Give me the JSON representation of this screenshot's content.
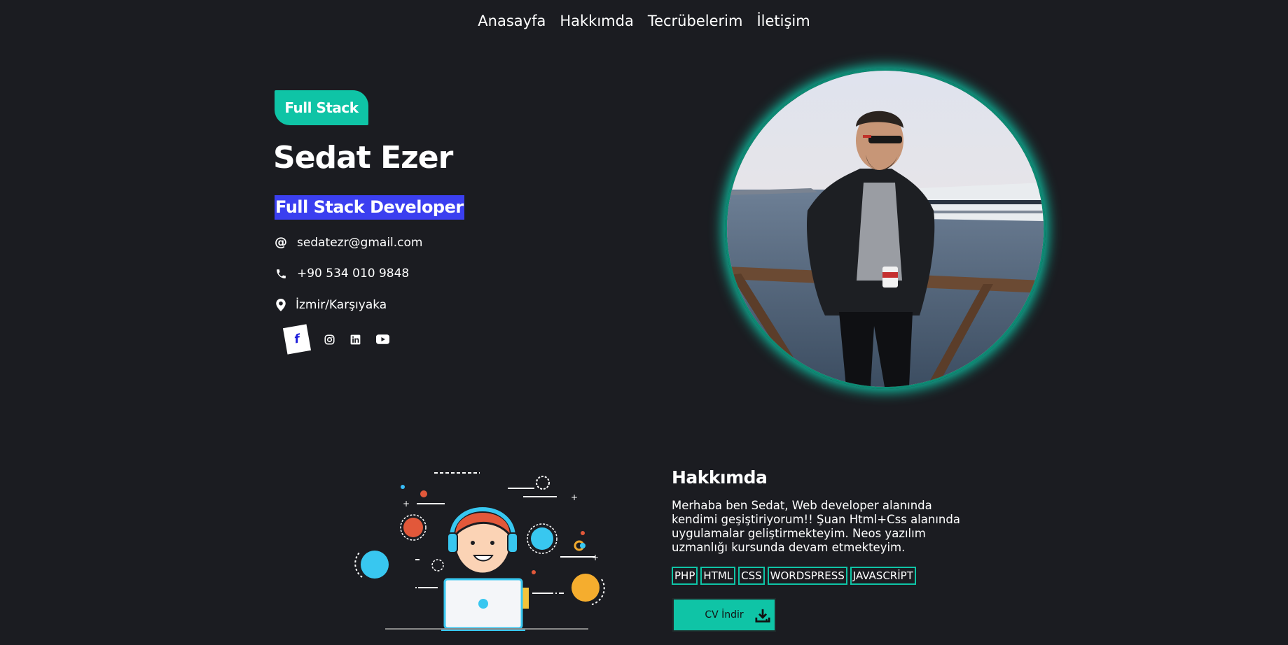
{
  "nav": {
    "items": [
      {
        "label": "Anasayfa"
      },
      {
        "label": "Hakkımda"
      },
      {
        "label": "Tecrübelerim"
      },
      {
        "label": "İletişim"
      }
    ]
  },
  "hero": {
    "badge": "Full Stack",
    "name": "Sedat Ezer",
    "role": "Full Stack Developer",
    "email": "sedatezr@gmail.com",
    "phone": "+90 534 010 9848",
    "location": "İzmir/Karşıyaka",
    "social": {
      "facebook": "f",
      "icons": [
        "facebook-icon",
        "instagram-icon",
        "linkedin-icon",
        "youtube-icon"
      ]
    }
  },
  "about": {
    "title": "Hakkımda",
    "text": "Merhaba ben Sedat, Web developer alanında kendimi geşiştiriyorum!! Şuan Html+Css alanında uygulamalar geliştirmekteyim. Neos yazılım uzmanlığı kursunda devam etmekteyim.",
    "skills": [
      "PHP",
      "HTML",
      "CSS",
      "WORDSPRESS",
      "JAVASCRİPT"
    ],
    "cv_button": "CV İndir"
  },
  "colors": {
    "background": "#1b1c21",
    "accent": "#0fc4a6",
    "highlight": "#3b3ff0"
  }
}
